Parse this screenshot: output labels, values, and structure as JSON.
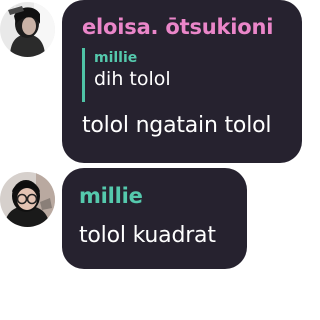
{
  "colors": {
    "bubble_bg": "#26222f",
    "author_pink": "#ea86c9",
    "author_teal": "#55c9ad",
    "reply_bar": "#4fc3a6",
    "text": "#ffffff"
  },
  "messages": [
    {
      "avatar_icon": "user-avatar-photo",
      "author": "eloisa. ōtsukioni",
      "author_color": "#ea86c9",
      "reply": {
        "author": "millie",
        "text": "dih tolol"
      },
      "text": "tolol ngatain tolol"
    },
    {
      "avatar_icon": "user-avatar-photo",
      "author": "millie",
      "author_color": "#55c9ad",
      "text": "tolol kuadrat"
    }
  ]
}
